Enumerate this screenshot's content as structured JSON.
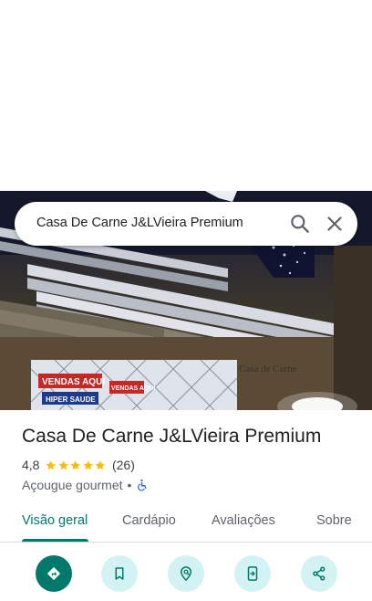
{
  "search": {
    "query": "Casa De Carne J&LVieira Premium"
  },
  "hero_photo": {
    "sign_texts": [
      "VENDAS AQUI",
      "VENDAS AQUI",
      "HIPER SAUDE",
      "Casa de Carne"
    ]
  },
  "place": {
    "name": "Casa De Carne J&LVieira Premium",
    "rating": "4,8",
    "stars": 5,
    "reviews": "(26)",
    "category": "Açougue gourmet",
    "separator": "•"
  },
  "tabs": [
    {
      "label": "Visão geral",
      "active": true
    },
    {
      "label": "Cardápio"
    },
    {
      "label": "Avaliações"
    },
    {
      "label": "Sobre"
    }
  ],
  "actions": [
    {
      "icon": "directions-icon"
    },
    {
      "icon": "bookmark-icon"
    },
    {
      "icon": "nearby-icon"
    },
    {
      "icon": "send-to-phone-icon"
    },
    {
      "icon": "share-icon"
    }
  ],
  "colors": {
    "accent": "#00796b",
    "action_bg": "#d3f2f4",
    "star": "#fbbc04",
    "wheelchair": "#1a73e8"
  }
}
